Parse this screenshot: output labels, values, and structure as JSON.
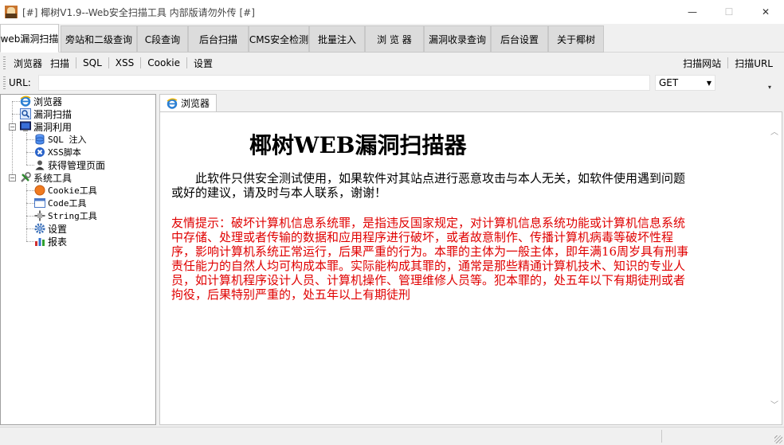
{
  "window": {
    "title": "[#] 椰树V1.9--Web安全扫描工具  内部版请勿外传 [#]",
    "minimize": "—",
    "maximize": "☐",
    "close": "✕"
  },
  "tabs": [
    {
      "label": "web漏洞扫描",
      "active": true
    },
    {
      "label": "旁站和二级查询"
    },
    {
      "label": "C段查询"
    },
    {
      "label": "后台扫描"
    },
    {
      "label": "CMS安全检测"
    },
    {
      "label": "批量注入"
    },
    {
      "label": "浏 览 器"
    },
    {
      "label": "漏洞收录查询"
    },
    {
      "label": "后台设置"
    },
    {
      "label": "关于椰树"
    }
  ],
  "toolbar": {
    "items": [
      "浏览器",
      "扫描",
      "SQL",
      "XSS",
      "Cookie",
      "设置"
    ],
    "right_items": [
      "扫描网站",
      "扫描URL"
    ]
  },
  "urlbar": {
    "label": "URL:",
    "value": "",
    "method": "GET"
  },
  "tree": {
    "browser": "浏览器",
    "vuln_scan": "漏洞扫描",
    "vuln_exploit": "漏洞利用",
    "sql_inject": "SQL 注入",
    "xss_script": "XSS脚本",
    "admin_page": "获得管理页面",
    "sys_tools": "系统工具",
    "cookie_tool": "Cookie工具",
    "code_tool": "Code工具",
    "string_tool": "String工具",
    "settings": "设置",
    "report": "报表"
  },
  "content": {
    "tab_label": "浏览器",
    "title": "椰树WEB漏洞扫描器",
    "intro": "此软件只供安全测试使用，如果软件对其站点进行恶意攻击与本人无关，如软件使用遇到问题或好的建议，请及时与本人联系，谢谢！",
    "warning": "友情提示：破坏计算机信息系统罪，是指违反国家规定，对计算机信息系统功能或计算机信息系统中存储、处理或者传输的数据和应用程序进行破坏，或者故意制作、传播计算机病毒等破坏性程序，影响计算机系统正常运行，后果严重的行为。本罪的主体为一般主体，即年满16周岁具有刑事责任能力的自然人均可构成本罪。实际能构成其罪的，通常是那些精通计算机技术、知识的专业人员，如计算机程序设计人员、计算机操作、管理维修人员等。犯本罪的，处五年以下有期徒刑或者拘役，后果特别严重的，处五年以上有期徒刑"
  },
  "colors": {
    "warning_text": "#e00000",
    "ie_icon": "#2b7fd3"
  }
}
